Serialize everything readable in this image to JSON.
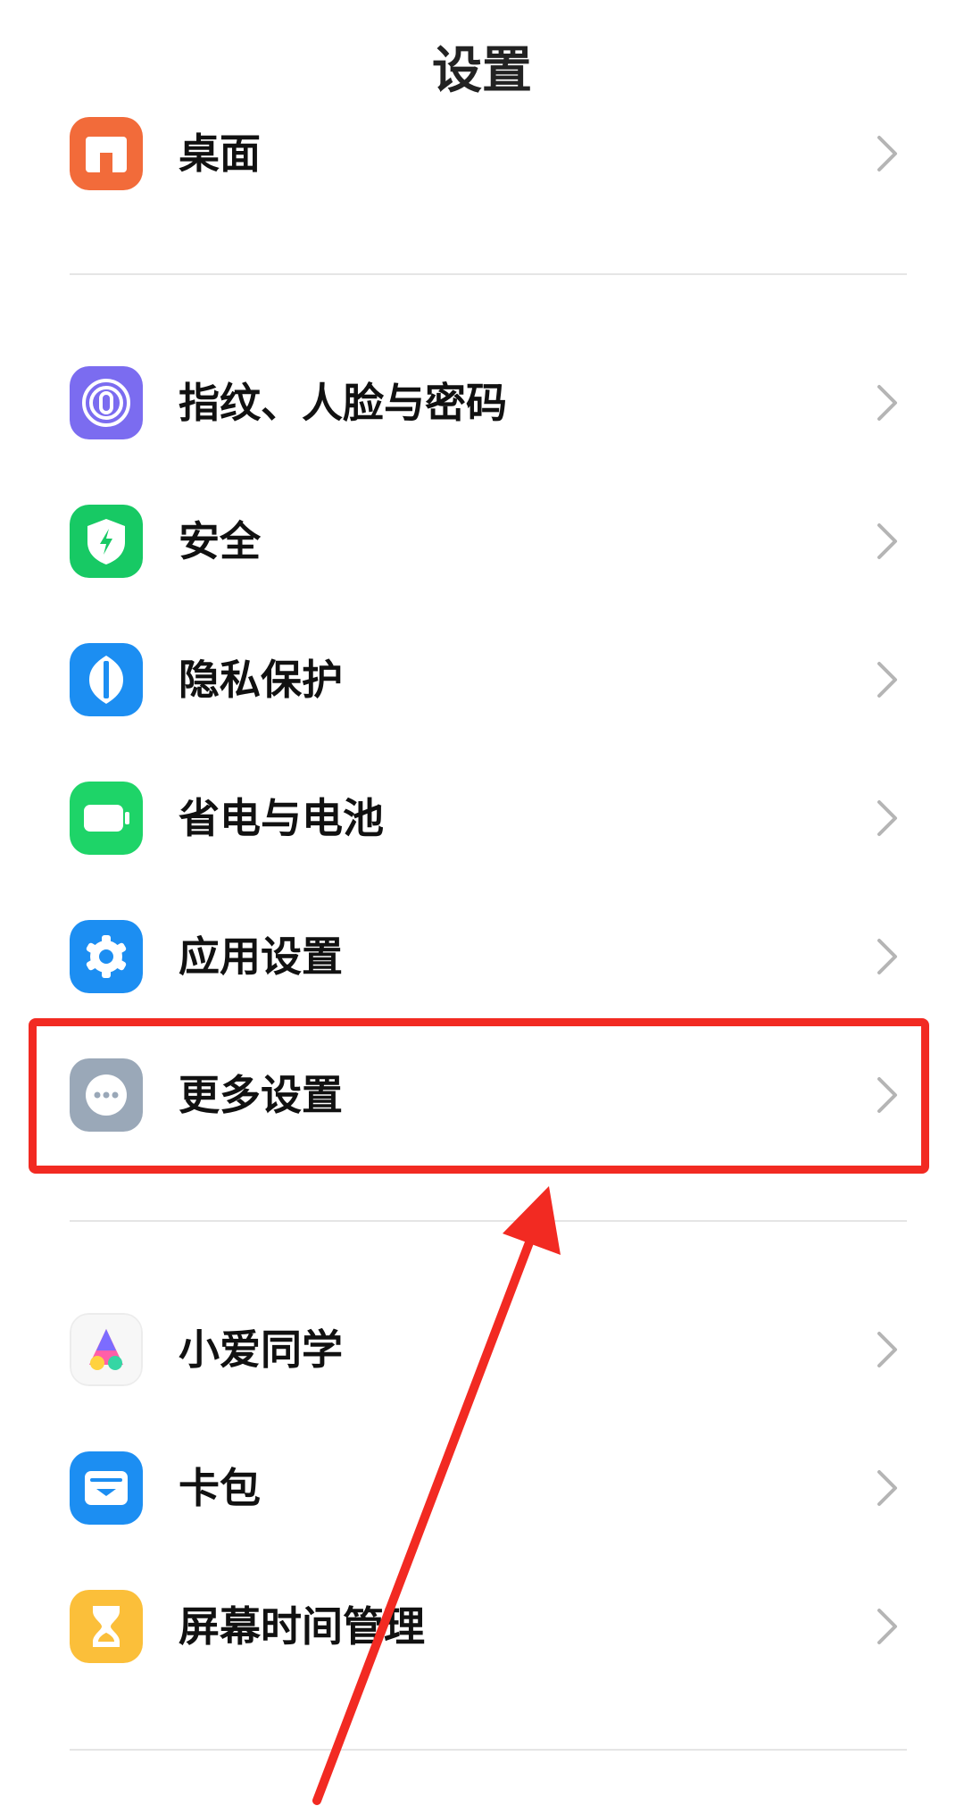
{
  "header": {
    "title": "设置"
  },
  "groups": [
    {
      "items": [
        {
          "label": "桌面",
          "icon": "home-icon"
        }
      ]
    },
    {
      "items": [
        {
          "label": "指纹、人脸与密码",
          "icon": "fingerprint-icon"
        },
        {
          "label": "安全",
          "icon": "shield-icon"
        },
        {
          "label": "隐私保护",
          "icon": "privacy-icon"
        },
        {
          "label": "省电与电池",
          "icon": "battery-icon"
        },
        {
          "label": "应用设置",
          "icon": "gear-icon"
        },
        {
          "label": "更多设置",
          "icon": "more-icon"
        }
      ]
    },
    {
      "items": [
        {
          "label": "小爱同学",
          "icon": "xiaoai-icon"
        },
        {
          "label": "卡包",
          "icon": "wallet-icon"
        },
        {
          "label": "屏幕时间管理",
          "icon": "hourglass-icon"
        }
      ]
    }
  ],
  "colors": {
    "annotation": "#f22a22",
    "desktop": "#f26b3a",
    "fingerprint": "#7b6cf0",
    "security": "#17c964",
    "privacy": "#1c8ef2",
    "battery": "#1ed468",
    "apps": "#1c8ef2",
    "more": "#9aa8b8",
    "wallet": "#1c8ef2",
    "screentime": "#fbbf3a"
  }
}
